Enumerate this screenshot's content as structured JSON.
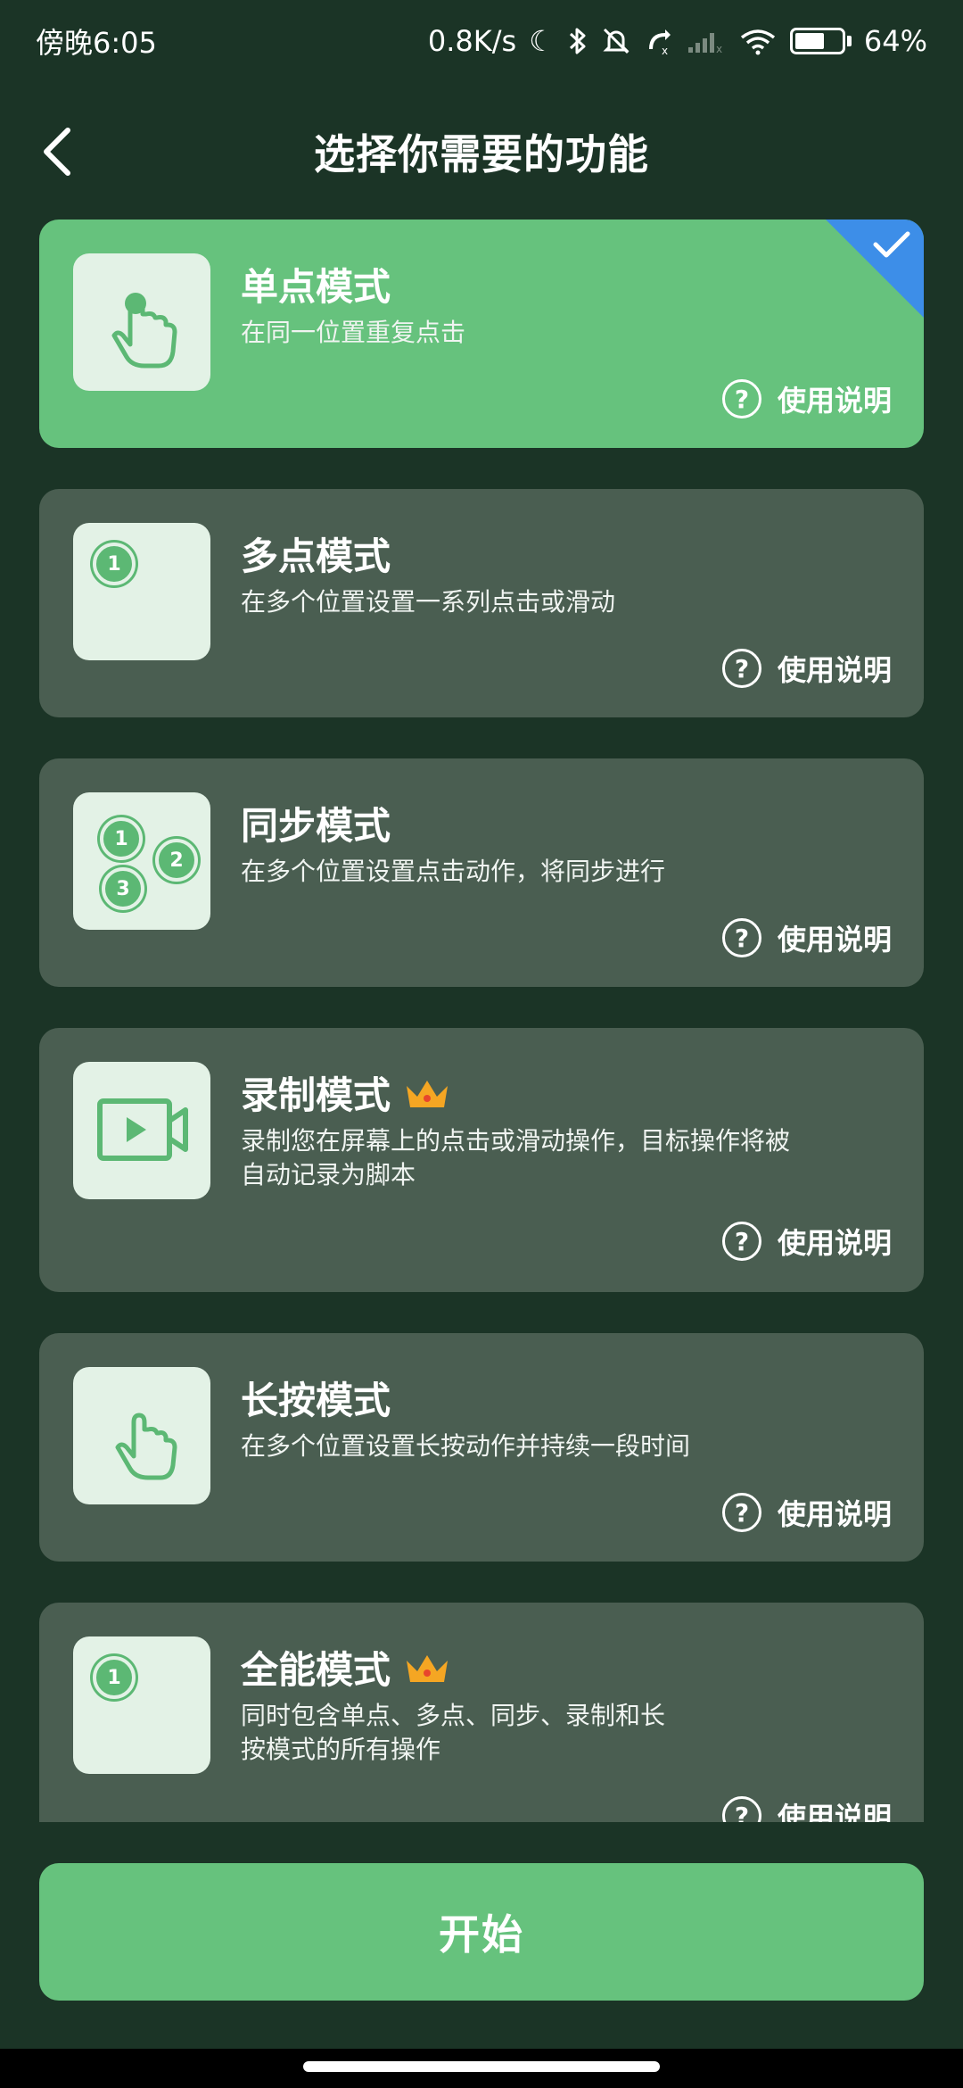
{
  "status": {
    "time": "傍晚6:05",
    "speed": "0.8K/s",
    "battery": "64%",
    "battery_level": 0.64
  },
  "header": {
    "title": "选择你需要的功能"
  },
  "help_label": "使用说明",
  "help_mark": "?",
  "modes": [
    {
      "title": "单点模式",
      "desc": "在同一位置重复点击",
      "selected": true
    },
    {
      "title": "多点模式",
      "desc": "在多个位置设置一系列点击或滑动",
      "numbers": [
        "1"
      ]
    },
    {
      "title": "同步模式",
      "desc": "在多个位置设置点击动作，将同步进行",
      "numbers": [
        "1",
        "2",
        "3"
      ]
    },
    {
      "title": "录制模式",
      "desc": "录制您在屏幕上的点击或滑动操作，目标操作将被自动记录为脚本",
      "premium": true
    },
    {
      "title": "长按模式",
      "desc": "在多个位置设置长按动作并持续一段时间"
    },
    {
      "title": "全能模式",
      "desc": "同时包含单点、多点、同步、录制和长按模式的所有操作",
      "premium": true,
      "numbers": [
        "1"
      ]
    }
  ],
  "start_button": "开始",
  "colors": {
    "background": "#1b3426",
    "card": "#4a5e51",
    "accent": "#66c27d",
    "selected_corner": "#3d8ee8"
  }
}
